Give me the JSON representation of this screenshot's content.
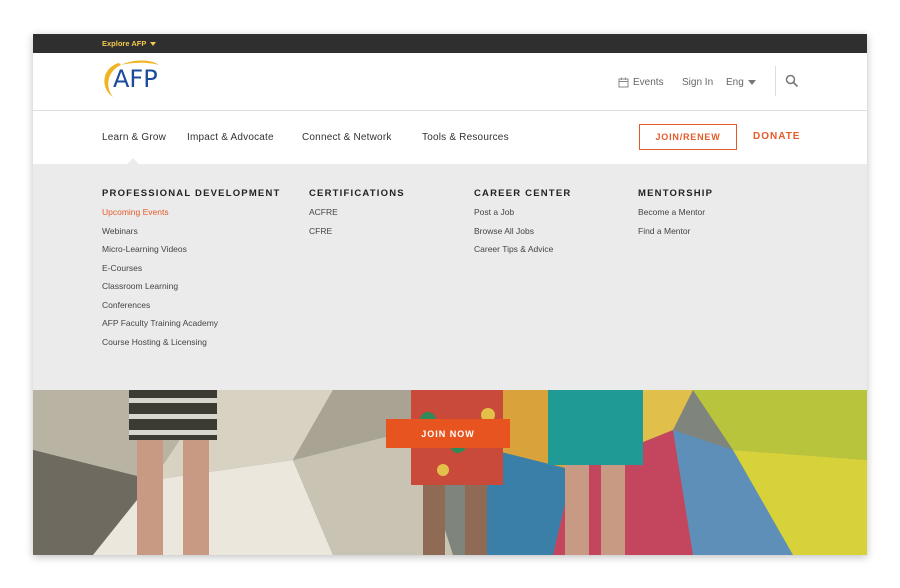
{
  "topbar": {
    "explore_label": "Explore AFP"
  },
  "header": {
    "logo_text": "AFP",
    "events_label": "Events",
    "signin_label": "Sign In",
    "language_label": "Eng"
  },
  "nav": {
    "items": [
      {
        "label": "Learn & Grow"
      },
      {
        "label": "Impact & Advocate"
      },
      {
        "label": "Connect & Network"
      },
      {
        "label": "Tools & Resources"
      }
    ],
    "join_renew_label": "JOIN/RENEW",
    "donate_label": "DONATE"
  },
  "mega_menu": {
    "columns": [
      {
        "heading": "PROFESSIONAL DEVELOPMENT",
        "links": [
          "Upcoming Events",
          "Webinars",
          "Micro-Learning Videos",
          "E-Courses",
          "Classroom Learning",
          "Conferences",
          "AFP Faculty Training Academy",
          "Course Hosting & Licensing"
        ]
      },
      {
        "heading": "CERTIFICATIONS",
        "links": [
          "ACFRE",
          "CFRE"
        ]
      },
      {
        "heading": "CAREER CENTER",
        "links": [
          "Post a Job",
          "Browse All Jobs",
          "Career Tips & Advice"
        ]
      },
      {
        "heading": "MENTORSHIP",
        "links": [
          "Become a Mentor",
          "Find a Mentor"
        ]
      }
    ]
  },
  "hero": {
    "join_now_label": "JOIN NOW"
  },
  "colors": {
    "accent": "#e65a28",
    "topbar": "#2f2f2f",
    "explore": "#f2c94c",
    "logo_blue": "#1b4c9c",
    "logo_gold": "#f0b323",
    "menu_bg": "#ebebeb"
  }
}
